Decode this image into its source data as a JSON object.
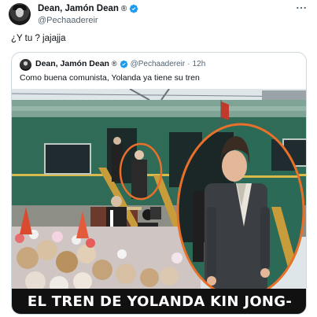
{
  "author": {
    "name": "Dean, Jamón Dean",
    "emoji": "®",
    "handle": "@Pechaadereir"
  },
  "tweet": {
    "text": "¿Y tu ? jajajja",
    "more_icon": "more-icon"
  },
  "quote": {
    "name": "Dean, Jamón Dean",
    "emoji": "®",
    "handle": "@Pechaadereir",
    "separator": "·",
    "time": "12h",
    "text": "Como buena comunista, Yolanda ya tiene su tren",
    "image_caption": "EL TREN DE YOLANDA KIN JONG-DIAZ"
  },
  "colors": {
    "verified": "#1d9bf0",
    "train": "#2f6b57",
    "highlight_circle": "#e8702a"
  }
}
